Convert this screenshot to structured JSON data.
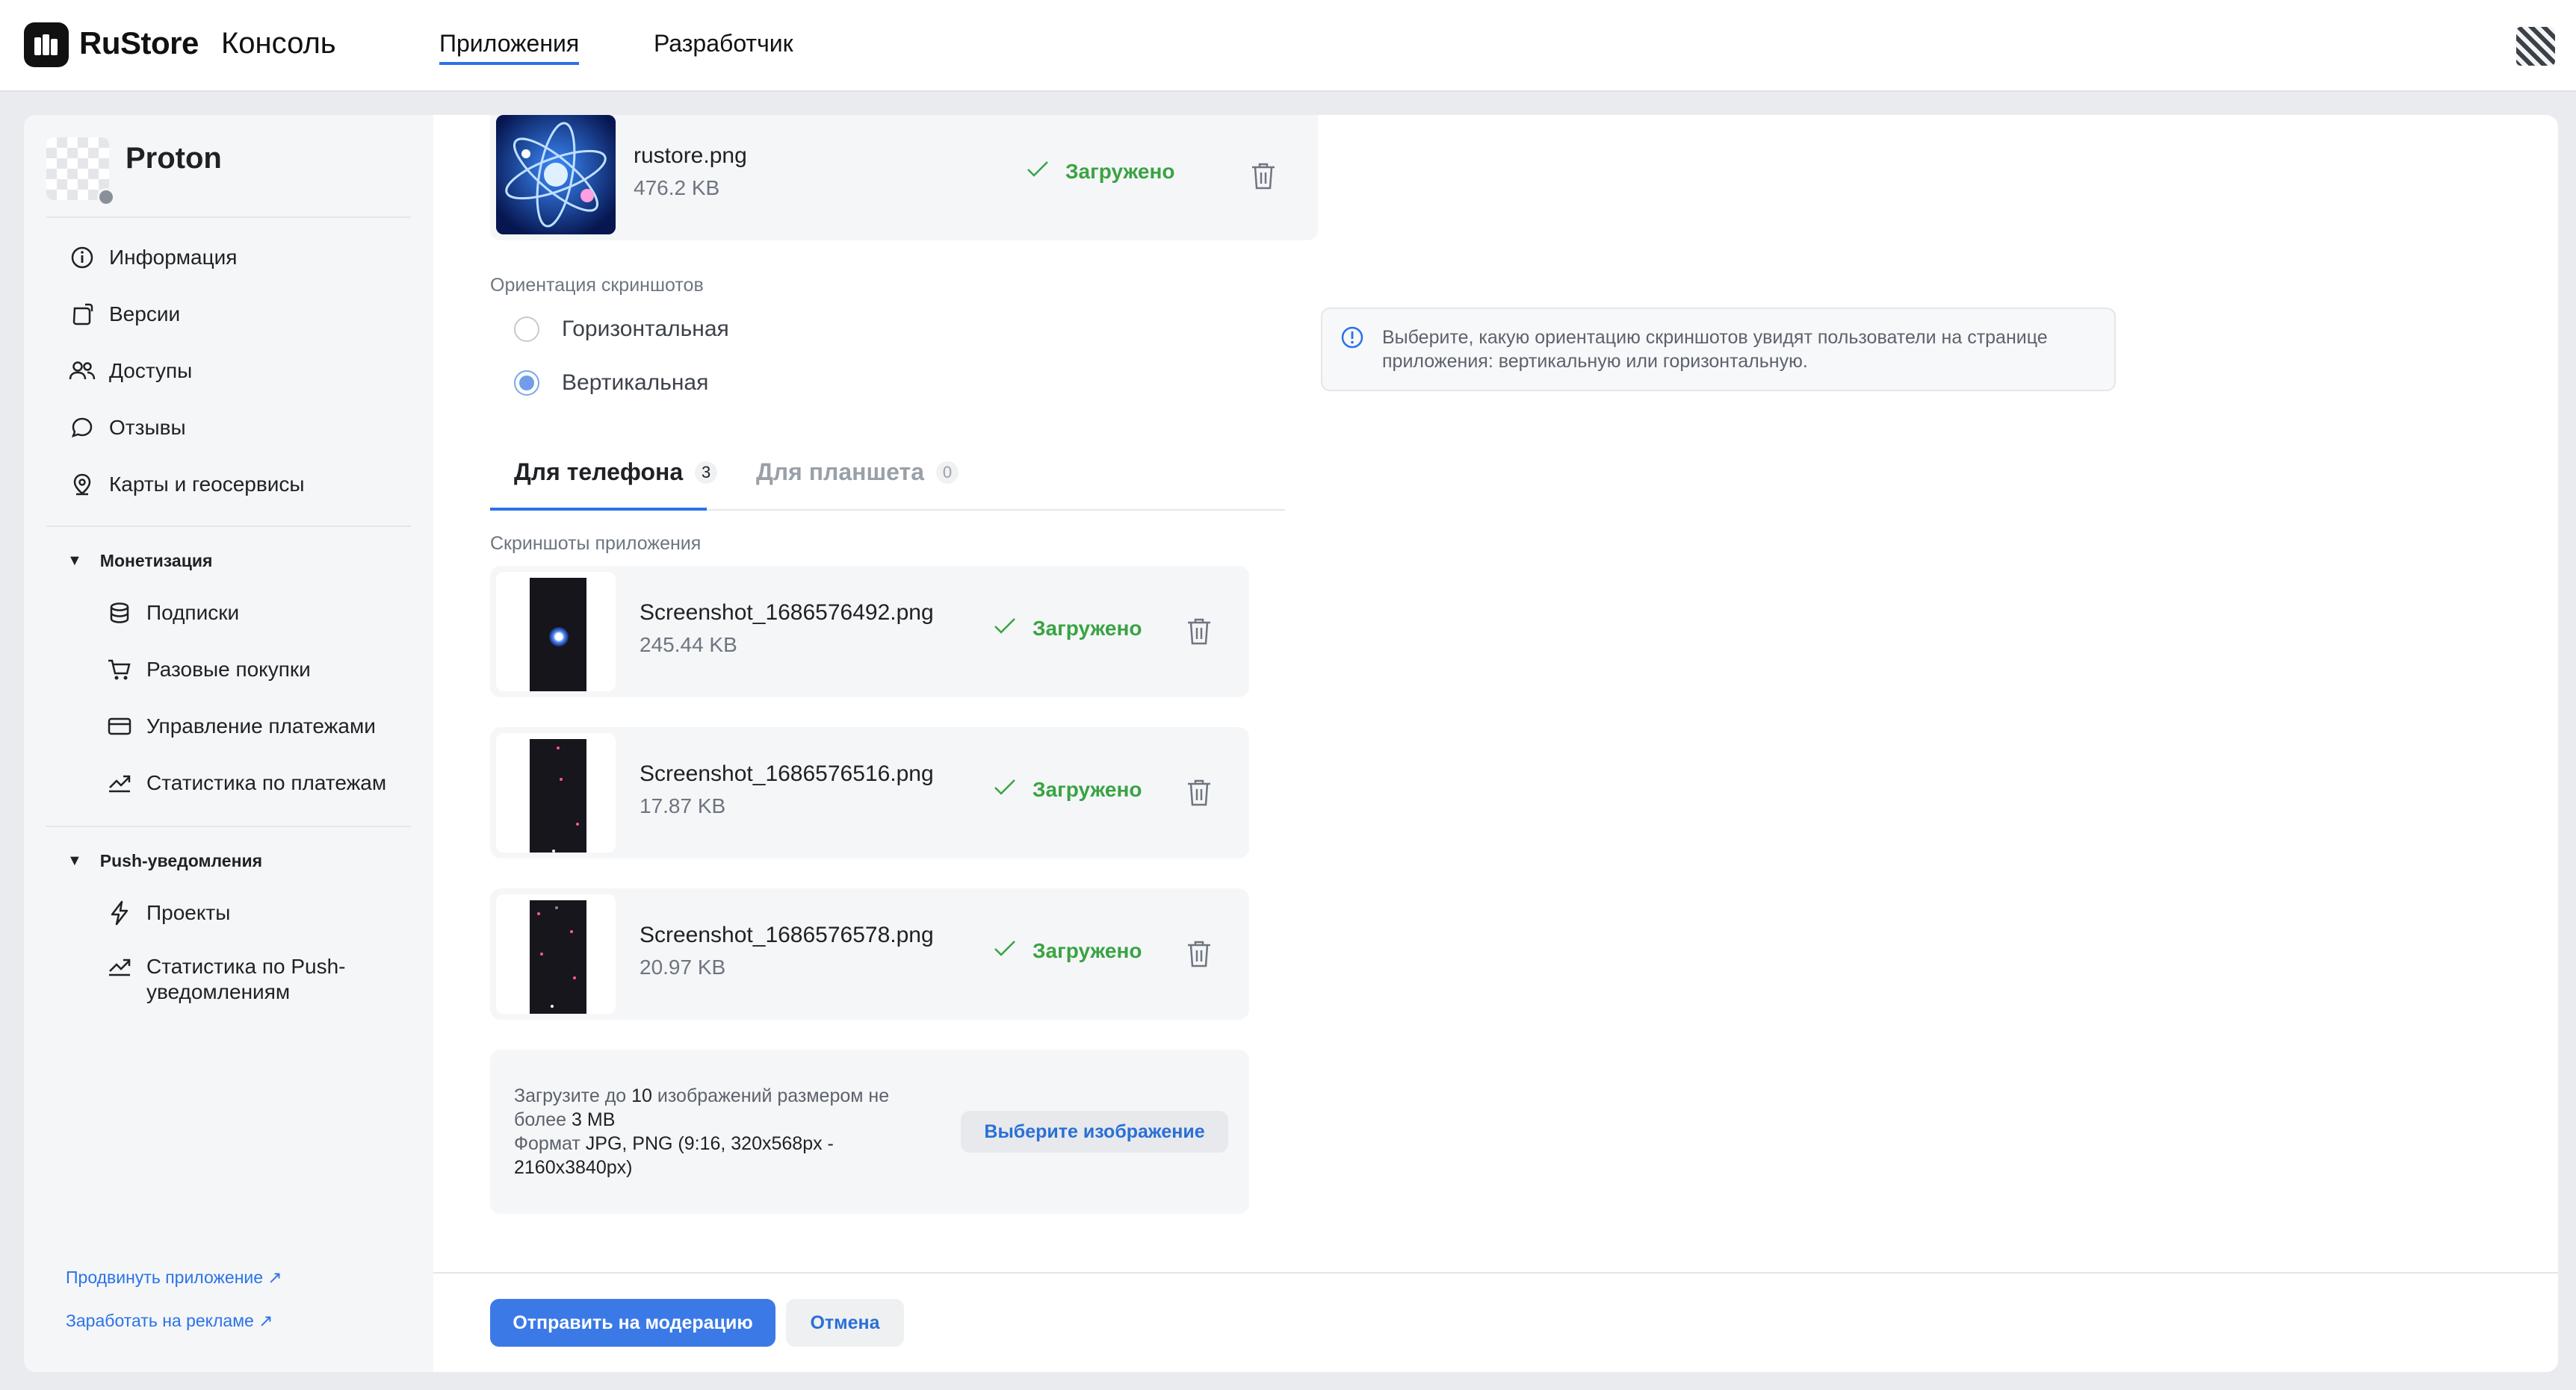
{
  "header": {
    "brand": "RuStore",
    "brand_sub": "Консоль",
    "nav": [
      {
        "label": "Приложения",
        "active": true
      },
      {
        "label": "Разработчик",
        "active": false
      }
    ]
  },
  "sidebar": {
    "app_name": "Proton",
    "items": [
      {
        "label": "Информация",
        "icon": "info-icon"
      },
      {
        "label": "Версии",
        "icon": "versions-icon"
      },
      {
        "label": "Доступы",
        "icon": "users-icon"
      },
      {
        "label": "Отзывы",
        "icon": "chat-icon"
      },
      {
        "label": "Карты и геосервисы",
        "icon": "location-pin-icon"
      }
    ],
    "monetization": {
      "title": "Монетизация",
      "items": [
        {
          "label": "Подписки",
          "icon": "database-icon"
        },
        {
          "label": "Разовые покупки",
          "icon": "cart-icon"
        },
        {
          "label": "Управление платежами",
          "icon": "card-icon"
        },
        {
          "label": "Статистика по платежам",
          "icon": "trend-icon"
        }
      ]
    },
    "push": {
      "title": "Push-уведомления",
      "items": [
        {
          "label": "Проекты",
          "icon": "lightning-icon"
        },
        {
          "label": "Статистика по Push-уведомлениям",
          "icon": "trend-icon"
        }
      ]
    },
    "links": [
      {
        "label": "Продвинуть приложение ↗"
      },
      {
        "label": "Заработать на рекламе ↗"
      }
    ]
  },
  "icon_file": {
    "name": "rustore.png",
    "size": "476.2 KB",
    "status": "Загружено"
  },
  "orientation": {
    "label": "Ориентация скриншотов",
    "options": [
      {
        "label": "Горизонтальная",
        "checked": false
      },
      {
        "label": "Вертикальная",
        "checked": true
      }
    ],
    "hint": "Выберите, какую ориентацию скриншотов увидят пользователи на странице приложения: вертикальную или горизонтальную."
  },
  "tabs": [
    {
      "label": "Для телефона",
      "count": "3",
      "active": true
    },
    {
      "label": "Для планшета",
      "count": "0",
      "active": false
    }
  ],
  "screenshots": {
    "label": "Скриншоты приложения",
    "files": [
      {
        "name": "Screenshot_1686576492.png",
        "size": "245.44 KB",
        "status": "Загружено"
      },
      {
        "name": "Screenshot_1686576516.png",
        "size": "17.87 KB",
        "status": "Загружено"
      },
      {
        "name": "Screenshot_1686576578.png",
        "size": "20.97 KB",
        "status": "Загружено"
      }
    ]
  },
  "upload": {
    "line1_pre": "Загрузите до ",
    "line1_num": "10",
    "line1_post": " изображений размером не более ",
    "line1_size": "3 MB",
    "line2_pre": "Формат ",
    "line2_fmt": "JPG, PNG (9:16, 320x568px - 2160x3840px)",
    "button": "Выберите изображение"
  },
  "footer": {
    "submit": "Отправить на модерацию",
    "cancel": "Отмена"
  },
  "colors": {
    "accent": "#2a73e8",
    "success": "#3aa343"
  }
}
